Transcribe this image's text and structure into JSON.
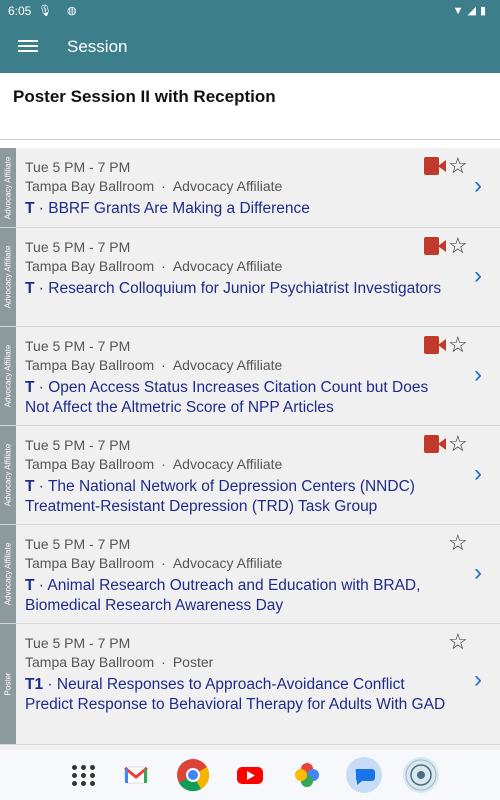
{
  "status_bar": {
    "time": "6:05"
  },
  "app_bar": {
    "title": "Session"
  },
  "session": {
    "title": "Poster Session II with Reception"
  },
  "rows": [
    {
      "tag": "Advocacy Affiliate",
      "time": "Tue 5 PM - 7 PM",
      "room": "Tampa Bay Ballroom",
      "dot": "·",
      "category": "Advocacy Affiliate",
      "code": "T",
      "sep": " · ",
      "title": "BBRF Grants Are Making a Difference",
      "has_video": true
    },
    {
      "tag": "Advocacy Affiliate",
      "time": "Tue 5 PM - 7 PM",
      "room": "Tampa Bay Ballroom",
      "dot": "·",
      "category": "Advocacy Affiliate",
      "code": "T",
      "sep": " · ",
      "title": "Research Colloquium for Junior Psychiatrist Investigators",
      "has_video": true
    },
    {
      "tag": "Advocacy Affiliate",
      "time": "Tue 5 PM - 7 PM",
      "room": "Tampa Bay Ballroom",
      "dot": "·",
      "category": "Advocacy Affiliate",
      "code": "T",
      "sep": " · ",
      "title": "Open Access Status Increases Citation Count but Does Not Affect the Altmetric Score of NPP Articles",
      "has_video": true
    },
    {
      "tag": "Advocacy Affiliate",
      "time": "Tue 5 PM - 7 PM",
      "room": "Tampa Bay Ballroom",
      "dot": "·",
      "category": "Advocacy Affiliate",
      "code": "T",
      "sep": " · ",
      "title": "The National Network of Depression Centers (NNDC) Treatment-Resistant Depression (TRD) Task Group",
      "has_video": true
    },
    {
      "tag": "Advocacy Affiliate",
      "time": "Tue 5 PM - 7 PM",
      "room": "Tampa Bay Ballroom",
      "dot": "·",
      "category": "Advocacy Affiliate",
      "code": "T",
      "sep": " · ",
      "title": "Animal Research Outreach and Education with BRAD, Biomedical Research Awareness Day",
      "has_video": false
    },
    {
      "tag": "Poster",
      "time": "Tue 5 PM - 7 PM",
      "room": "Tampa Bay Ballroom",
      "dot": "·",
      "category": "Poster",
      "code": "T1",
      "sep": " · ",
      "title": "Neural Responses to Approach-Avoidance Conflict Predict Response to Behavioral Therapy for Adults With GAD",
      "has_video": false
    }
  ],
  "icons": {
    "star": "☆",
    "chevron": "›"
  },
  "colors": {
    "app_bar": "#3c7f8a",
    "title_link": "#1f2b8a",
    "video": "#c0392b",
    "chevron": "#1e6fd0"
  }
}
